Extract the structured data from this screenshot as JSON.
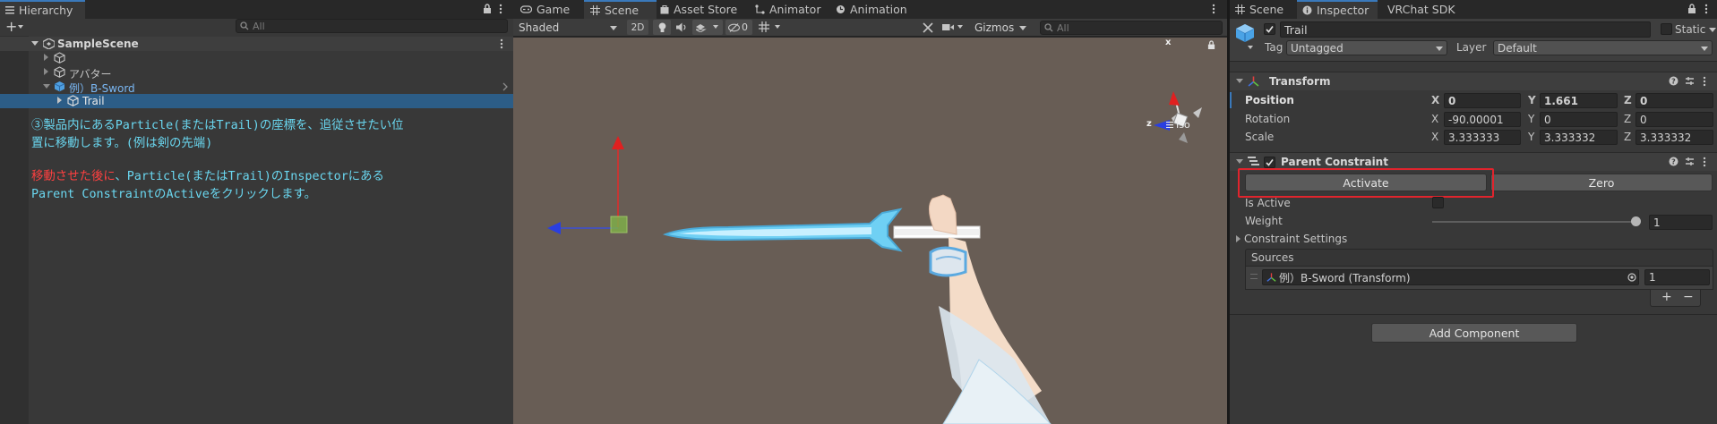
{
  "hierarchy": {
    "tab_label": "Hierarchy",
    "add_label": "+",
    "search_placeholder": "All",
    "scene_name": "SampleScene",
    "items": [
      {
        "label": ""
      },
      {
        "label": "アバター"
      },
      {
        "label": "例）B-Sword"
      },
      {
        "label": "Trail"
      }
    ],
    "instructions": {
      "line1": "③製品内にあるParticle(またはTrail)の座標を、追従させたい位",
      "line2": "置に移動します。(例は剣の先端)",
      "line3_red": "移動させた後に",
      "line3_rest": "、Particle(またはTrail)のInspectorにある",
      "line4": "Parent ConstraintのActiveをクリックします。",
      "cyan": "#6ad7f0",
      "red": "#ff4040"
    }
  },
  "center": {
    "tabs": [
      {
        "label": "Game",
        "icon": "gamepad-icon"
      },
      {
        "label": "Scene",
        "icon": "grid-icon"
      },
      {
        "label": "Asset Store",
        "icon": "bag-icon"
      },
      {
        "label": "Animator",
        "icon": "animator-icon"
      },
      {
        "label": "Animation",
        "icon": "clock-icon"
      }
    ],
    "toolbar": {
      "shading": "Shaded",
      "mode_2d": "2D",
      "hidden_count": "0",
      "gizmos": "Gizmos",
      "search_placeholder": "All"
    },
    "gizmo": {
      "x_label": "x",
      "z_label": "z",
      "projection": "Iso"
    }
  },
  "right_tabs": [
    {
      "label": "Scene",
      "icon": "grid-icon"
    },
    {
      "label": "Inspector",
      "icon": "info-icon"
    },
    {
      "label": "VRChat SDK",
      "icon": ""
    }
  ],
  "inspector": {
    "object_name": "Trail",
    "static_label": "Static",
    "tag_label": "Tag",
    "tag_value": "Untagged",
    "layer_label": "Layer",
    "layer_value": "Default",
    "transform": {
      "title": "Transform",
      "position_label": "Position",
      "rotation_label": "Rotation",
      "scale_label": "Scale",
      "position": {
        "x": "0",
        "y": "1.661",
        "z": "0"
      },
      "rotation": {
        "x": "-90.00001",
        "y": "0",
        "z": "0"
      },
      "scale": {
        "x": "3.333333",
        "y": "3.333332",
        "z": "3.333332"
      },
      "axis_x": "X",
      "axis_y": "Y",
      "axis_z": "Z"
    },
    "constraint": {
      "title": "Parent Constraint",
      "activate_label": "Activate",
      "zero_label": "Zero",
      "is_active_label": "Is Active",
      "weight_label": "Weight",
      "weight_value": "1",
      "weight_fraction": 1.0,
      "settings_label": "Constraint Settings",
      "sources_label": "Sources",
      "source_name": "例）B-Sword (Transform)",
      "source_weight": "1",
      "plus_label": "+",
      "minus_label": "−"
    },
    "add_component_label": "Add Component",
    "highlight_color": "#e0242d"
  }
}
